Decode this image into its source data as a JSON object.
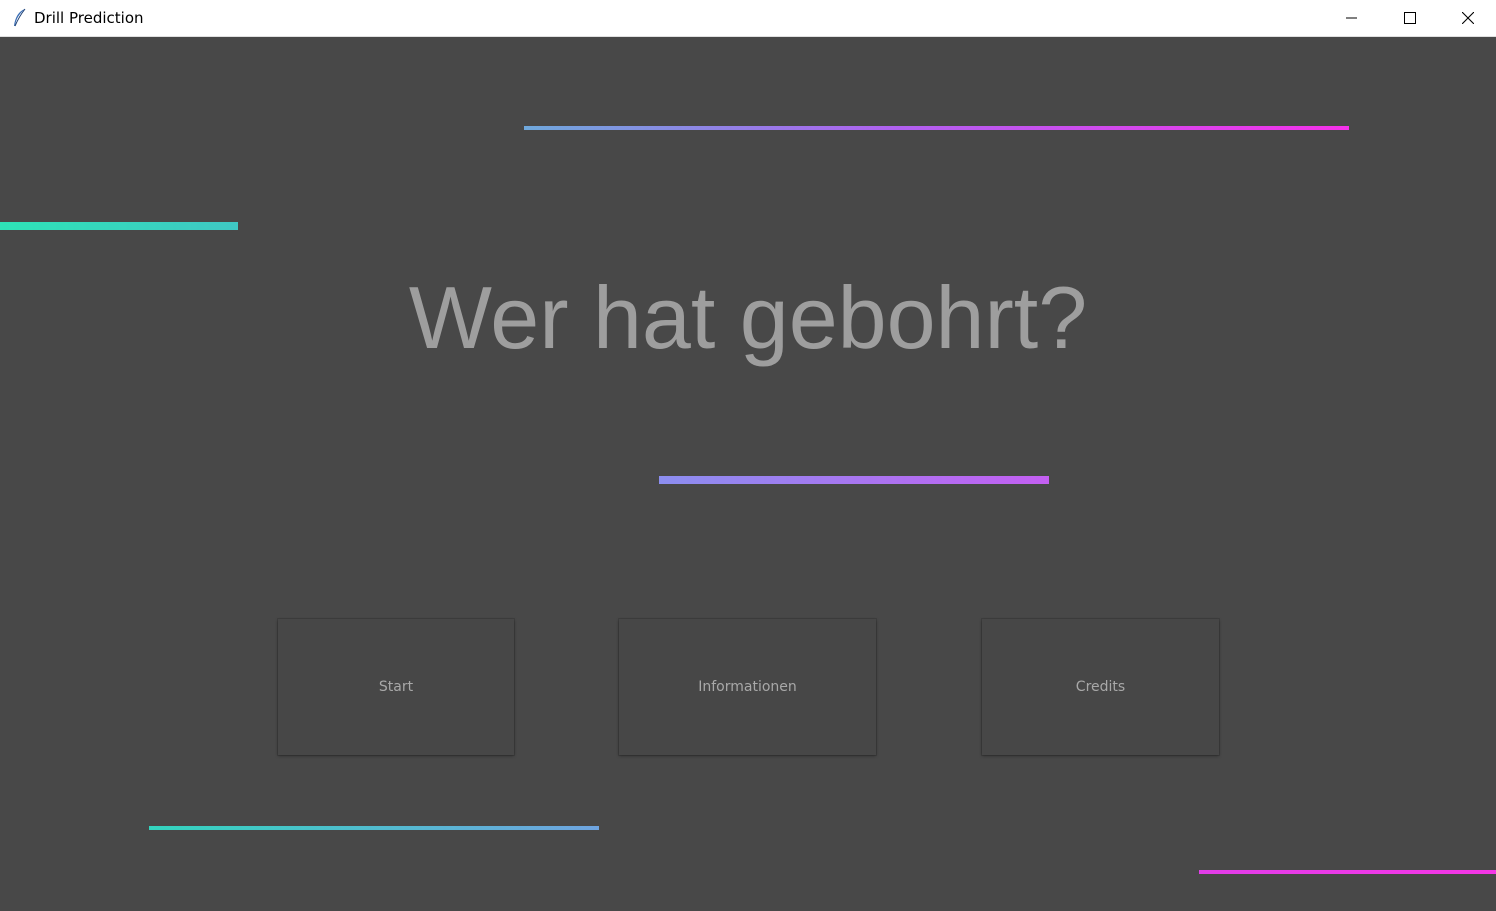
{
  "window": {
    "title": "Drill Prediction",
    "icon": "feather-icon",
    "controls": {
      "minimize_icon": "minimize-icon",
      "maximize_icon": "maximize-icon",
      "close_icon": "close-icon"
    }
  },
  "main": {
    "headline": "Wer hat gebohrt?",
    "buttons": {
      "start": "Start",
      "info": "Informationen",
      "credits": "Credits"
    }
  },
  "colors": {
    "background": "#484848",
    "headline_text": "#9e9e9e",
    "button_text": "#a8a8a8",
    "accent_teal": "#2ee3b7",
    "accent_blue": "#6fa8dc",
    "accent_purple": "#b061f0",
    "accent_magenta": "#f531ea"
  }
}
